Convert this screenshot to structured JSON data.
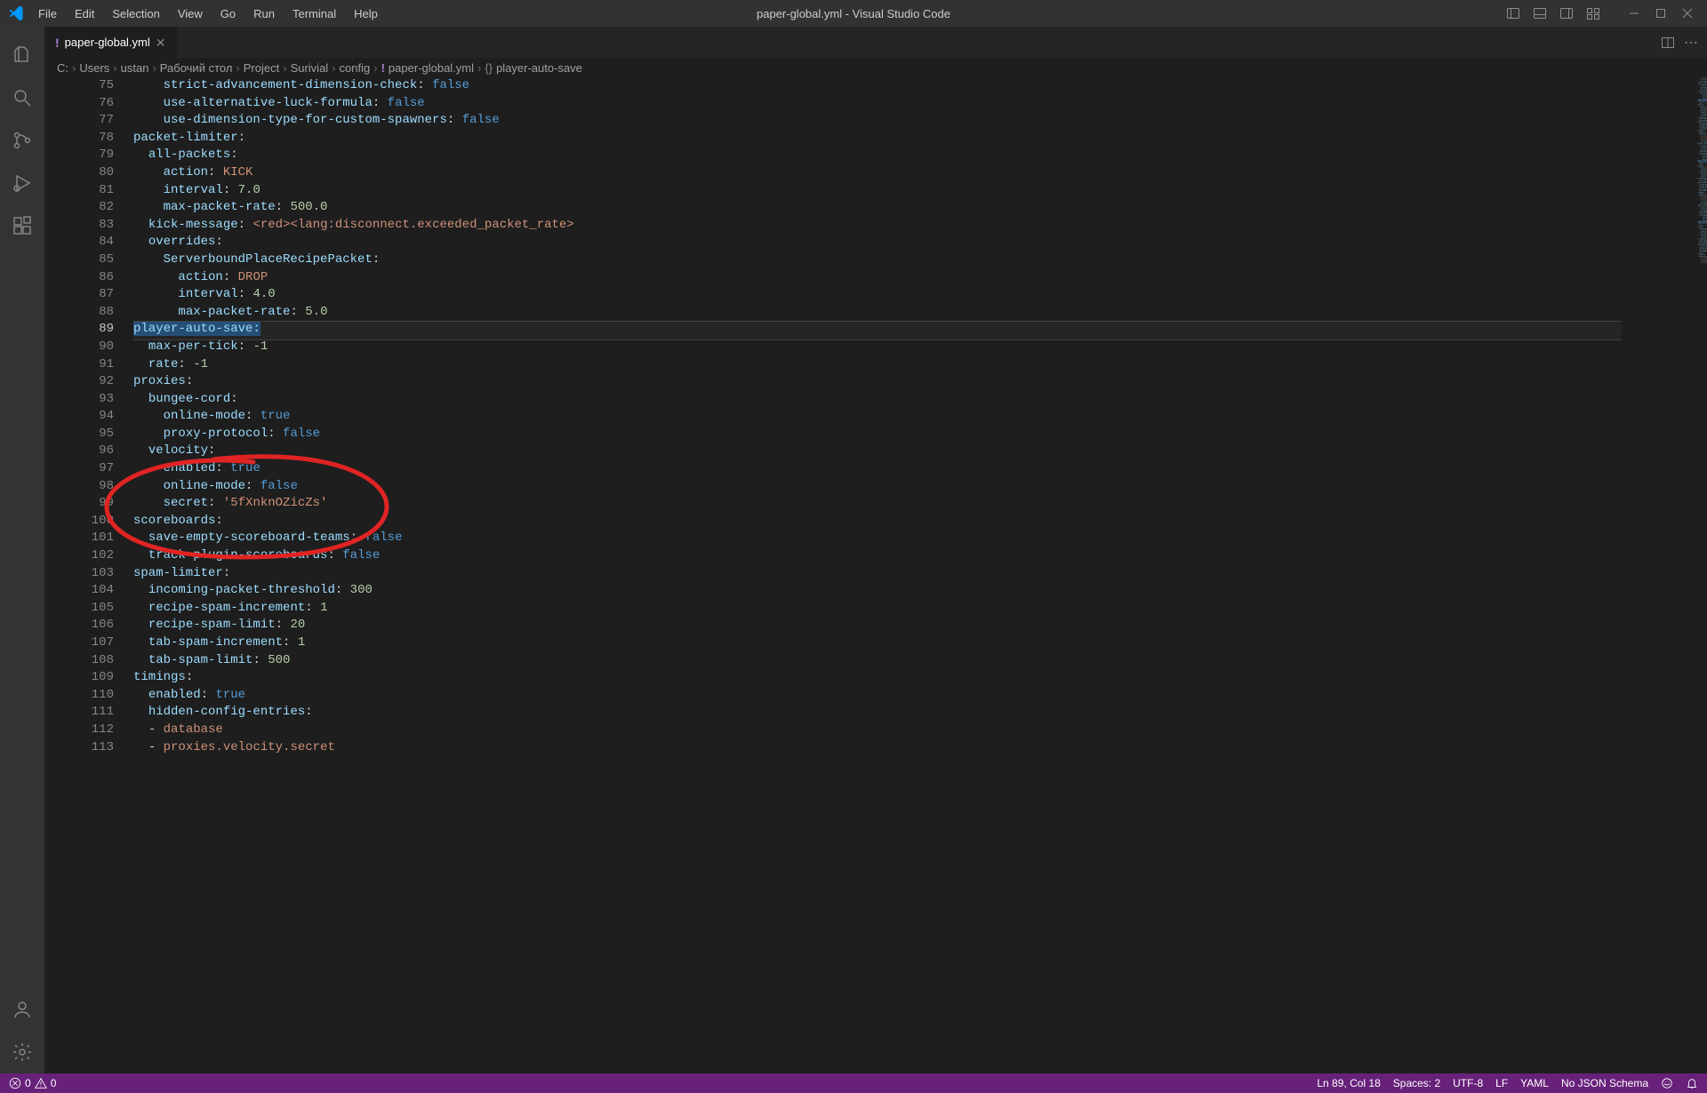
{
  "menus": [
    "File",
    "Edit",
    "Selection",
    "View",
    "Go",
    "Run",
    "Terminal",
    "Help"
  ],
  "windowTitle": "paper-global.yml - Visual Studio Code",
  "tab": {
    "label": "paper-global.yml"
  },
  "breadcrumbs": [
    "C:",
    "Users",
    "ustan",
    "Рабочий стол",
    "Project",
    "Surivial",
    "config"
  ],
  "breadcrumbFile": "paper-global.yml",
  "breadcrumbSymbol": "player-auto-save",
  "statusbar": {
    "errors": "0",
    "warnings": "0",
    "lnCol": "Ln 89, Col 18",
    "spaces": "Spaces: 2",
    "encoding": "UTF-8",
    "eol": "LF",
    "lang": "YAML",
    "schema": "No JSON Schema"
  },
  "code": [
    {
      "n": 75,
      "html": "    <span class='k'>strict-advancement-dimension-check</span><span class='pc'>:</span> <span class='v-bool'>false</span>"
    },
    {
      "n": 76,
      "html": "    <span class='k'>use-alternative-luck-formula</span><span class='pc'>:</span> <span class='v-bool'>false</span>"
    },
    {
      "n": 77,
      "html": "    <span class='k'>use-dimension-type-for-custom-spawners</span><span class='pc'>:</span> <span class='v-bool'>false</span>"
    },
    {
      "n": 78,
      "html": "<span class='k'>packet-limiter</span><span class='pc'>:</span>"
    },
    {
      "n": 79,
      "html": "  <span class='k'>all-packets</span><span class='pc'>:</span>"
    },
    {
      "n": 80,
      "html": "    <span class='k'>action</span><span class='pc'>:</span> <span class='v-const'>KICK</span>"
    },
    {
      "n": 81,
      "html": "    <span class='k'>interval</span><span class='pc'>:</span> <span class='v-num'>7.0</span>"
    },
    {
      "n": 82,
      "html": "    <span class='k'>max-packet-rate</span><span class='pc'>:</span> <span class='v-num'>500.0</span>"
    },
    {
      "n": 83,
      "html": "  <span class='k'>kick-message</span><span class='pc'>:</span> <span class='v-str'>&lt;red&gt;&lt;lang:disconnect.exceeded_packet_rate&gt;</span>"
    },
    {
      "n": 84,
      "html": "  <span class='k'>overrides</span><span class='pc'>:</span>"
    },
    {
      "n": 85,
      "html": "    <span class='k'>ServerboundPlaceRecipePacket</span><span class='pc'>:</span>"
    },
    {
      "n": 86,
      "html": "      <span class='k'>action</span><span class='pc'>:</span> <span class='v-const'>DROP</span>"
    },
    {
      "n": 87,
      "html": "      <span class='k'>interval</span><span class='pc'>:</span> <span class='v-num'>4.0</span>"
    },
    {
      "n": 88,
      "html": "      <span class='k'>max-packet-rate</span><span class='pc'>:</span> <span class='v-num'>5.0</span>"
    },
    {
      "n": 89,
      "cur": true,
      "html": "<span class='highlighted-key'>player-auto-save</span><span class='pc highlighted-key'>:</span>"
    },
    {
      "n": 90,
      "html": "  <span class='k'>max-per-tick</span><span class='pc'>:</span> <span class='v-num'>-1</span>"
    },
    {
      "n": 91,
      "html": "  <span class='k'>rate</span><span class='pc'>:</span> <span class='v-num'>-1</span>"
    },
    {
      "n": 92,
      "html": "<span class='k'>proxies</span><span class='pc'>:</span>"
    },
    {
      "n": 93,
      "html": "  <span class='k'>bungee-cord</span><span class='pc'>:</span>"
    },
    {
      "n": 94,
      "html": "    <span class='k'>online-mode</span><span class='pc'>:</span> <span class='v-bool'>true</span>"
    },
    {
      "n": 95,
      "html": "    <span class='k'>proxy-protocol</span><span class='pc'>:</span> <span class='v-bool'>false</span>"
    },
    {
      "n": 96,
      "html": "  <span class='k'>velocity</span><span class='pc'>:</span>"
    },
    {
      "n": 97,
      "html": "    <span class='k'>enabled</span><span class='pc'>:</span> <span class='v-bool'>true</span>"
    },
    {
      "n": 98,
      "html": "    <span class='k'>online-mode</span><span class='pc'>:</span> <span class='v-bool'>false</span>"
    },
    {
      "n": 99,
      "html": "    <span class='k'>secret</span><span class='pc'>:</span> <span class='v-str'>'5fXnknOZicZs'</span>"
    },
    {
      "n": 100,
      "html": "<span class='k'>scoreboards</span><span class='pc'>:</span>"
    },
    {
      "n": 101,
      "html": "  <span class='k'>save-empty-scoreboard-teams</span><span class='pc'>:</span> <span class='v-bool'>false</span>"
    },
    {
      "n": 102,
      "html": "  <span class='k'>track-plugin-scoreboards</span><span class='pc'>:</span> <span class='v-bool'>false</span>"
    },
    {
      "n": 103,
      "html": "<span class='k'>spam-limiter</span><span class='pc'>:</span>"
    },
    {
      "n": 104,
      "html": "  <span class='k'>incoming-packet-threshold</span><span class='pc'>:</span> <span class='v-num'>300</span>"
    },
    {
      "n": 105,
      "html": "  <span class='k'>recipe-spam-increment</span><span class='pc'>:</span> <span class='v-num'>1</span>"
    },
    {
      "n": 106,
      "html": "  <span class='k'>recipe-spam-limit</span><span class='pc'>:</span> <span class='v-num'>20</span>"
    },
    {
      "n": 107,
      "html": "  <span class='k'>tab-spam-increment</span><span class='pc'>:</span> <span class='v-num'>1</span>"
    },
    {
      "n": 108,
      "html": "  <span class='k'>tab-spam-limit</span><span class='pc'>:</span> <span class='v-num'>500</span>"
    },
    {
      "n": 109,
      "html": "<span class='k'>timings</span><span class='pc'>:</span>"
    },
    {
      "n": 110,
      "html": "  <span class='k'>enabled</span><span class='pc'>:</span> <span class='v-bool'>true</span>"
    },
    {
      "n": 111,
      "html": "  <span class='k'>hidden-config-entries</span><span class='pc'>:</span>"
    },
    {
      "n": 112,
      "html": "  <span class='pc'>-</span> <span class='v-const'>database</span>"
    },
    {
      "n": 113,
      "html": "  <span class='pc'>-</span> <span class='v-const'>proxies.velocity.secret</span>"
    }
  ]
}
